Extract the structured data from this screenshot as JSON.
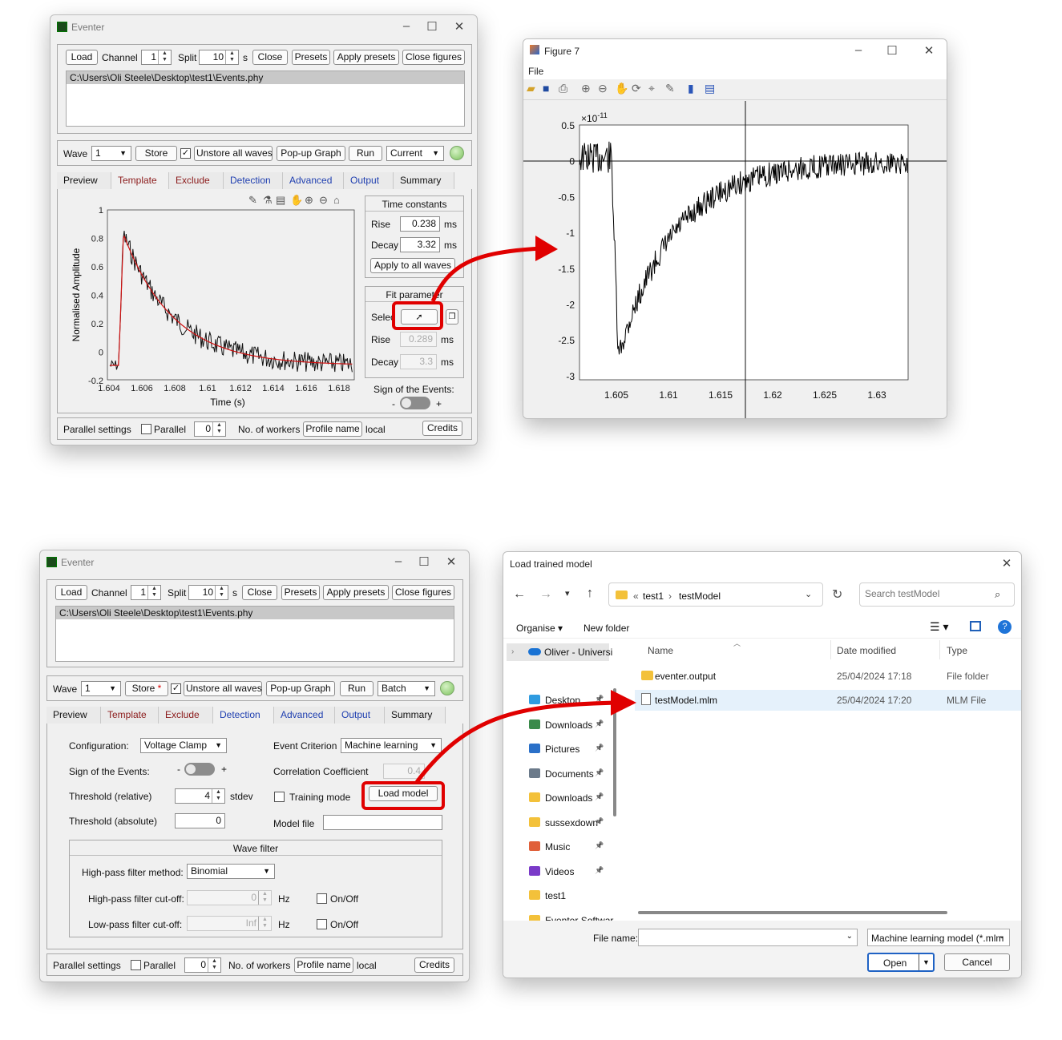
{
  "eventer_template": {
    "title": "Eventer",
    "toolbar": {
      "load": "Load",
      "channel_label": "Channel",
      "channel_value": "1",
      "split_label": "Split",
      "split_value": "10",
      "split_unit": "s",
      "close": "Close",
      "presets": "Presets",
      "apply_presets": "Apply presets",
      "close_figures": "Close figures"
    },
    "file_path": "C:\\Users\\Oli Steele\\Desktop\\test1\\Events.phy",
    "wave_bar": {
      "wave_label": "Wave",
      "wave_value": "1",
      "store": "Store",
      "unstore": "Unstore all waves",
      "popup": "Pop-up Graph",
      "run": "Run",
      "mode": "Current"
    },
    "tabs": [
      "Preview",
      "Template",
      "Exclude",
      "Detection",
      "Advanced",
      "Output",
      "Summary"
    ],
    "plot": {
      "ylabel": "Normalised Amplitude",
      "xlabel": "Time (s)",
      "yticks": [
        "1",
        "0.8",
        "0.6",
        "0.4",
        "0.2",
        "0",
        "-0.2"
      ],
      "xticks": [
        "1.604",
        "1.606",
        "1.608",
        "1.61",
        "1.612",
        "1.614",
        "1.616",
        "1.618"
      ],
      "toolbar_icons": [
        "brush-icon",
        "flask-icon",
        "data-tip-icon",
        "pan-icon",
        "zoom-in-icon",
        "zoom-out-icon",
        "home-icon"
      ]
    },
    "time_constants": {
      "title": "Time constants",
      "rise_label": "Rise",
      "rise_value": "0.238",
      "rise_unit": "ms",
      "decay_label": "Decay",
      "decay_value": "3.32",
      "decay_unit": "ms",
      "apply": "Apply to all waves"
    },
    "fit_params": {
      "title": "Fit parameter",
      "select_label": "Selec",
      "rise_label": "Rise",
      "rise_value": "0.289",
      "rise_unit": "ms",
      "decay_label": "Decay",
      "decay_value": "3.3",
      "decay_unit": "ms"
    },
    "sign": {
      "label": "Sign of the Events:",
      "minus": "-",
      "plus": "+"
    },
    "parallel": {
      "label": "Parallel settings",
      "parallel": "Parallel",
      "workers_value": "0",
      "workers_label": "No. of workers",
      "profile": "Profile name",
      "profile_value": "local",
      "credits": "Credits"
    }
  },
  "figure7": {
    "title": "Figure 7",
    "menu": "File",
    "exponent": "×10",
    "exponent_power": "-11",
    "yticks": [
      "0.5",
      "0",
      "-0.5",
      "-1",
      "-1.5",
      "-2",
      "-2.5",
      "-3"
    ],
    "xticks": [
      "1.605",
      "1.61",
      "1.615",
      "1.62",
      "1.625",
      "1.63"
    ],
    "toolbar_icons": [
      "open-icon",
      "save-icon",
      "print-icon",
      "zoom-in-icon",
      "zoom-out-icon",
      "pan-icon",
      "rotate-icon",
      "data-cursor-icon",
      "brush-icon",
      "colorbar-icon",
      "legend-icon"
    ]
  },
  "eventer_detection": {
    "title": "Eventer",
    "toolbar": {
      "load": "Load",
      "channel_label": "Channel",
      "channel_value": "1",
      "split_label": "Split",
      "split_value": "10",
      "split_unit": "s",
      "close": "Close",
      "presets": "Presets",
      "apply_presets": "Apply presets",
      "close_figures": "Close figures"
    },
    "file_path": "C:\\Users\\Oli Steele\\Desktop\\test1\\Events.phy",
    "wave_bar": {
      "wave_label": "Wave",
      "wave_value": "1",
      "store": "Store",
      "store_mark": "*",
      "unstore": "Unstore all waves",
      "popup": "Pop-up Graph",
      "run": "Run",
      "mode": "Batch"
    },
    "tabs": [
      "Preview",
      "Template",
      "Exclude",
      "Detection",
      "Advanced",
      "Output",
      "Summary"
    ],
    "detection": {
      "config_label": "Configuration:",
      "config_value": "Voltage Clamp",
      "criterion_label": "Event Criterion",
      "criterion_value": "Machine learning",
      "sign_label": "Sign of the Events:",
      "sign_minus": "-",
      "sign_plus": "+",
      "corr_label": "Correlation Coefficient",
      "corr_value": "0.4",
      "thr_rel_label": "Threshold (relative)",
      "thr_rel_value": "4",
      "thr_rel_unit": "stdev",
      "training_label": "Training mode",
      "load_model": "Load model",
      "thr_abs_label": "Threshold (absolute)",
      "thr_abs_value": "0",
      "model_file_label": "Model file",
      "model_file_value": ""
    },
    "wave_filter": {
      "title": "Wave filter",
      "hp_method_label": "High-pass filter method:",
      "hp_method_value": "Binomial",
      "hp_cutoff_label": "High-pass filter cut-off:",
      "hp_cutoff_value": "0",
      "hp_unit": "Hz",
      "hp_onoff": "On/Off",
      "lp_cutoff_label": "Low-pass filter cut-off:",
      "lp_cutoff_value": "Inf",
      "lp_unit": "Hz",
      "lp_onoff": "On/Off"
    },
    "parallel": {
      "label": "Parallel settings",
      "parallel": "Parallel",
      "workers_value": "0",
      "workers_label": "No. of workers",
      "profile": "Profile name",
      "profile_value": "local",
      "credits": "Credits"
    }
  },
  "load_dialog": {
    "title": "Load trained model",
    "breadcrumb": [
      "«",
      "test1",
      "›",
      "testModel"
    ],
    "search_placeholder": "Search testModel",
    "organise": "Organise",
    "new_folder": "New folder",
    "nav_onedrive": "Oliver - Universi",
    "nav_items": [
      "Desktop",
      "Downloads",
      "Pictures",
      "Documents",
      "Downloads",
      "sussexdown",
      "Music",
      "Videos",
      "test1",
      "Eventer Softwar"
    ],
    "columns": [
      "Name",
      "Date modified",
      "Type"
    ],
    "files": [
      {
        "name": "eventer.output",
        "date": "25/04/2024 17:18",
        "type": "File folder"
      },
      {
        "name": "testModel.mlm",
        "date": "25/04/2024 17:20",
        "type": "MLM File"
      }
    ],
    "file_name_label": "File name:",
    "file_name_value": "",
    "filter": "Machine learning model (*.mlm",
    "open": "Open",
    "cancel": "Cancel"
  }
}
